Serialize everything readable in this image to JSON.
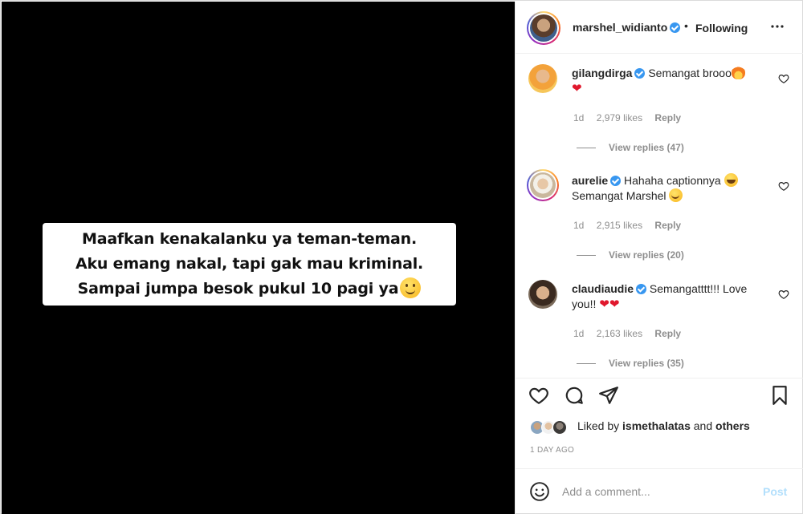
{
  "post": {
    "caption_lines": [
      "Maafkan kenakalanku ya teman-teman.",
      "Aku emang nakal, tapi gak mau kriminal.",
      "Sampai jumpa besok pukul 10 pagi ya"
    ]
  },
  "header": {
    "username": "marshel_widianto",
    "separator": "•",
    "following_label": "Following"
  },
  "comments": [
    {
      "username": "gilangdirga",
      "text": "Semangat brooo",
      "age": "1d",
      "likes": "2,979 likes",
      "reply_label": "Reply",
      "view_replies": "View replies (47)"
    },
    {
      "username": "aurelie",
      "text": "Hahaha captionnya",
      "text_line2": "Semangat Marshel",
      "age": "1d",
      "likes": "2,915 likes",
      "reply_label": "Reply",
      "view_replies": "View replies (20)"
    },
    {
      "username": "claudiaudie",
      "text": "Semangatttt!!! Love",
      "text_line2": "you!!",
      "age": "1d",
      "likes": "2,163 likes",
      "reply_label": "Reply",
      "view_replies": "View replies (35)"
    }
  ],
  "likes": {
    "prefix": "Liked by",
    "user": "ismethalatas",
    "connector": "and",
    "others": "others"
  },
  "timestamp": "1 DAY AGO",
  "add_comment": {
    "placeholder": "Add a comment...",
    "post_label": "Post"
  },
  "colors": {
    "verified": "#3897f0",
    "post_disabled": "#b2dffc",
    "heart": "#e0182d"
  }
}
